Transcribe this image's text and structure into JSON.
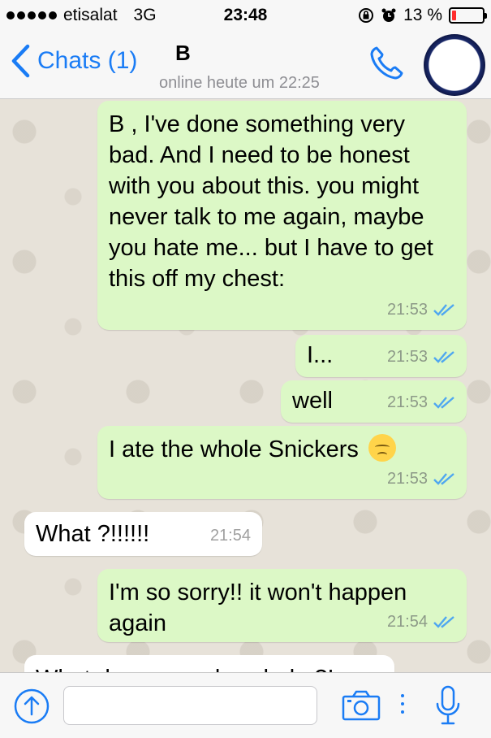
{
  "status_bar": {
    "carrier": "etisalat",
    "network": "3G",
    "time": "23:48",
    "battery": "13 %",
    "battery_level": 0.13
  },
  "header": {
    "back_label": "Chats (1)",
    "contact_name": "B",
    "contact_status": "online heute um 22:25"
  },
  "messages": [
    {
      "dir": "out",
      "text": "B       , I've done something very bad. And I need to be honest with you about this. you might never talk to me again, maybe you hate me... but I have to get this off my chest:",
      "time": "21:53"
    },
    {
      "dir": "out",
      "text": "I...",
      "time": "21:53"
    },
    {
      "dir": "out",
      "text": "well",
      "time": "21:53"
    },
    {
      "dir": "out",
      "text": "I ate the whole Snickers",
      "time": "21:53",
      "emoji": "pensive-face"
    },
    {
      "dir": "in",
      "text": "What ?!!!!!!",
      "time": "21:54"
    },
    {
      "dir": "out",
      "text": "I'm so sorry!! it won't happen again",
      "time": "21:54"
    },
    {
      "dir": "in",
      "text": "What do u mean by whole ?!",
      "time": ""
    }
  ],
  "input": {
    "placeholder": ""
  },
  "colors": {
    "accent": "#1a7cf5",
    "outgoing_bubble": "#dcf8c6",
    "incoming_bubble": "#ffffff",
    "read_ticks": "#4fa7f0",
    "battery_low": "#ff2d2d"
  }
}
